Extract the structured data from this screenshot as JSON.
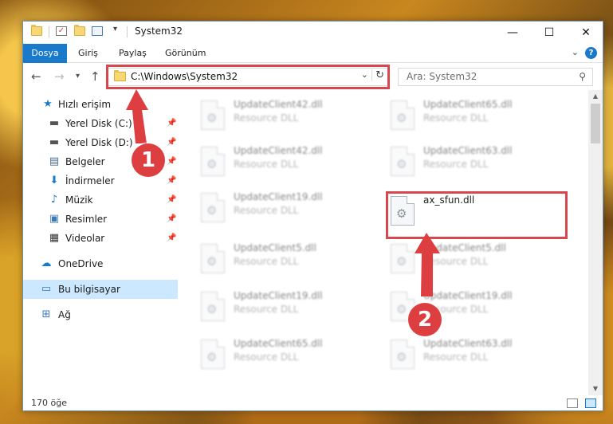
{
  "window": {
    "title": "System32",
    "controls": {
      "minimize": "—",
      "maximize": "☐",
      "close": "✕"
    }
  },
  "ribbon": {
    "tabs": [
      "Dosya",
      "Giriş",
      "Paylaş",
      "Görünüm"
    ],
    "help": "?"
  },
  "address": {
    "path": "C:\\Windows\\System32",
    "search_placeholder": "Ara: System32"
  },
  "sidebar": {
    "items": [
      {
        "label": "Hızlı erişim",
        "icon": "star-icon",
        "pinned": false
      },
      {
        "label": "Yerel Disk (C:)",
        "icon": "drive-icon",
        "pinned": true
      },
      {
        "label": "Yerel Disk (D:)",
        "icon": "drive-icon",
        "pinned": true
      },
      {
        "label": "Belgeler",
        "icon": "document-icon",
        "pinned": true
      },
      {
        "label": "İndirmeler",
        "icon": "download-icon",
        "pinned": true
      },
      {
        "label": "Müzik",
        "icon": "music-icon",
        "pinned": true
      },
      {
        "label": "Resimler",
        "icon": "pictures-icon",
        "pinned": true
      },
      {
        "label": "Videolar",
        "icon": "video-icon",
        "pinned": true
      },
      {
        "label": "OneDrive",
        "icon": "cloud-icon",
        "pinned": false
      },
      {
        "label": "Bu bilgisayar",
        "icon": "computer-icon",
        "pinned": false,
        "selected": true
      },
      {
        "label": "Ağ",
        "icon": "network-icon",
        "pinned": false
      }
    ]
  },
  "files": [
    {
      "name": "UpdateClient42.dll",
      "desc": "Resource DLL"
    },
    {
      "name": "UpdateClient65.dll",
      "desc": "Resource DLL"
    },
    {
      "name": "UpdateClient42.dll",
      "desc": "Resource DLL"
    },
    {
      "name": "UpdateClient63.dll",
      "desc": "Resource DLL"
    },
    {
      "name": "UpdateClient19.dll",
      "desc": "Resource DLL"
    },
    {
      "name": "ax_sfun.dll",
      "desc": "",
      "highlighted": true
    },
    {
      "name": "UpdateClient5.dll",
      "desc": "Resource DLL"
    },
    {
      "name": "UpdateClient5.dll",
      "desc": "Resource DLL"
    },
    {
      "name": "UpdateClient19.dll",
      "desc": "Resource DLL"
    },
    {
      "name": "UpdateClient19.dll",
      "desc": "Resource DLL"
    },
    {
      "name": "UpdateClient65.dll",
      "desc": "Resource DLL"
    },
    {
      "name": "UpdateClient63.dll",
      "desc": "Resource DLL"
    }
  ],
  "status": {
    "count": "170 öğe"
  },
  "annotations": {
    "marker1": "1",
    "marker2": "2",
    "accent": "#dd3f41"
  }
}
